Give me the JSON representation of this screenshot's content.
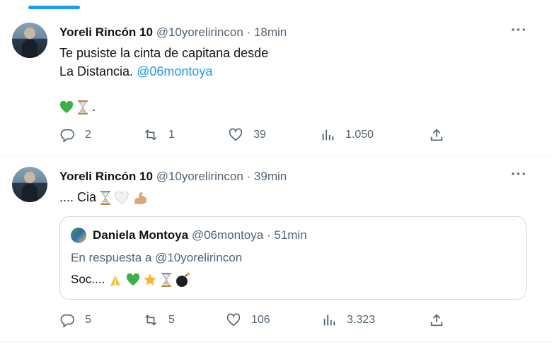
{
  "tweets": [
    {
      "name": "Yoreli Rincón 10",
      "handle": "@10yorelirincon",
      "dot": "·",
      "time": "18min",
      "line1": "Te pusiste la cinta de capitana desde",
      "line2": "La Distancia.",
      "mention": "@06montoya",
      "emoji_suffix": ".",
      "replies": "2",
      "retweets": "1",
      "likes": "39",
      "views": "1.050"
    },
    {
      "name": "Yoreli Rincón 10",
      "handle": "@10yorelirincon",
      "dot": "·",
      "time": "39min",
      "text": ".... Cia",
      "replies": "5",
      "retweets": "5",
      "likes": "106",
      "views": "3.323",
      "quote": {
        "name": "Daniela Montoya",
        "handle": "@06montoya",
        "dot": "·",
        "time": "51min",
        "reply_to": "En respuesta a @10yorelirincon",
        "text": "Soc...."
      }
    }
  ],
  "more_label": "···",
  "icons": [
    "reply-icon",
    "retweet-icon",
    "like-icon",
    "views-icon",
    "share-icon",
    "more-icon"
  ],
  "colors": {
    "accent": "#1d9bf0",
    "muted": "#536471",
    "text": "#0f1419"
  }
}
